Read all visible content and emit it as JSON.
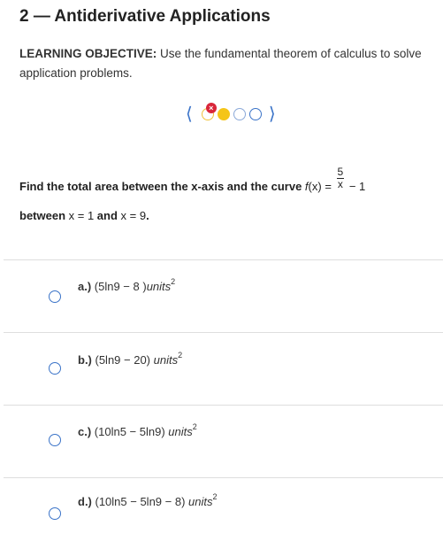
{
  "title": "2 — Antiderivative Applications",
  "objective": {
    "label": "LEARNING OBJECTIVE:",
    "text": " Use the fundamental theorem of calculus to solve application problems."
  },
  "pager": {
    "prev": "⟨",
    "next": "⟩",
    "wrong_mark": "×",
    "dot_states": [
      "incorrect",
      "current",
      "pending",
      "pending"
    ]
  },
  "question": {
    "intro": "Find the total area between the x-axis and the curve ",
    "func_name": "f",
    "func_arg": "(x) = ",
    "frac_num": "5",
    "frac_den": "x",
    "func_tail": " − 1",
    "between": "between ",
    "bound1": "x = 1",
    "and": " and ",
    "bound2": "x = 9",
    "end": "."
  },
  "options": [
    {
      "letter": "a.)",
      "expr": " (5ln9 − 8 )",
      "unit": "units",
      "exp": "2"
    },
    {
      "letter": "b.)",
      "expr": " (5ln9 − 20) ",
      "unit": "units",
      "exp": "2"
    },
    {
      "letter": "c.)",
      "expr": " (10ln5 − 5ln9) ",
      "unit": "units",
      "exp": "2"
    },
    {
      "letter": "d.)",
      "expr": " (10ln5 − 5ln9 − 8) ",
      "unit": "units",
      "exp": "2"
    }
  ]
}
